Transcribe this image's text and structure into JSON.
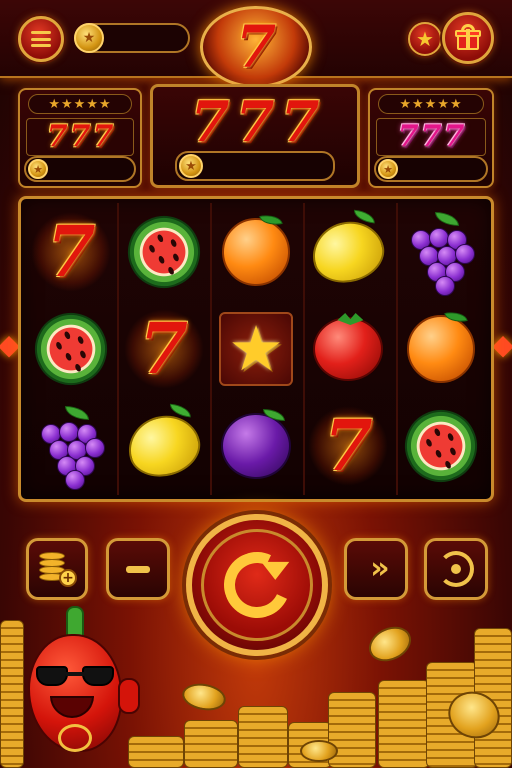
{
  "header": {
    "menu_icon": "menu-icon",
    "balance_icon": "star-coin-icon",
    "balance_value": "",
    "logo_text": "7",
    "favorites_icon": "star-icon",
    "gift_icon": "gift-icon"
  },
  "jackpots": {
    "left": {
      "stars": "★★★★★",
      "symbols": [
        "7",
        "7",
        "7"
      ],
      "amount": "",
      "color": "#e2160d"
    },
    "center": {
      "symbols": [
        "7",
        "7",
        "7"
      ],
      "amount": "",
      "color": "#e2160d"
    },
    "right": {
      "stars": "★★★★★",
      "symbols": [
        "7",
        "7",
        "7"
      ],
      "amount": "",
      "color": "#e3158a"
    }
  },
  "reels": {
    "grid": [
      [
        "seven",
        "watermelon",
        "orange",
        "lemon",
        "grapes"
      ],
      [
        "watermelon",
        "seven",
        "star",
        "tomato",
        "orange"
      ],
      [
        "grapes",
        "lemon",
        "plum",
        "seven",
        "watermelon"
      ]
    ],
    "seven_text": "7",
    "star_text": "★"
  },
  "controls": {
    "add_coins_icon": "coins-plus-icon",
    "decrease_bet_icon": "minus-icon",
    "spin_icon": "spin-arrow-icon",
    "turbo_icon": "fast-forward-icon",
    "autoplay_icon": "autoplay-icon",
    "minus_label": "",
    "turbo_label": "»"
  },
  "side_arrows": {
    "left": "◆",
    "right": "◆"
  },
  "colors": {
    "accent_gold": "#f0b446",
    "frame_red": "#8a0a06",
    "background": "#3a0604"
  }
}
